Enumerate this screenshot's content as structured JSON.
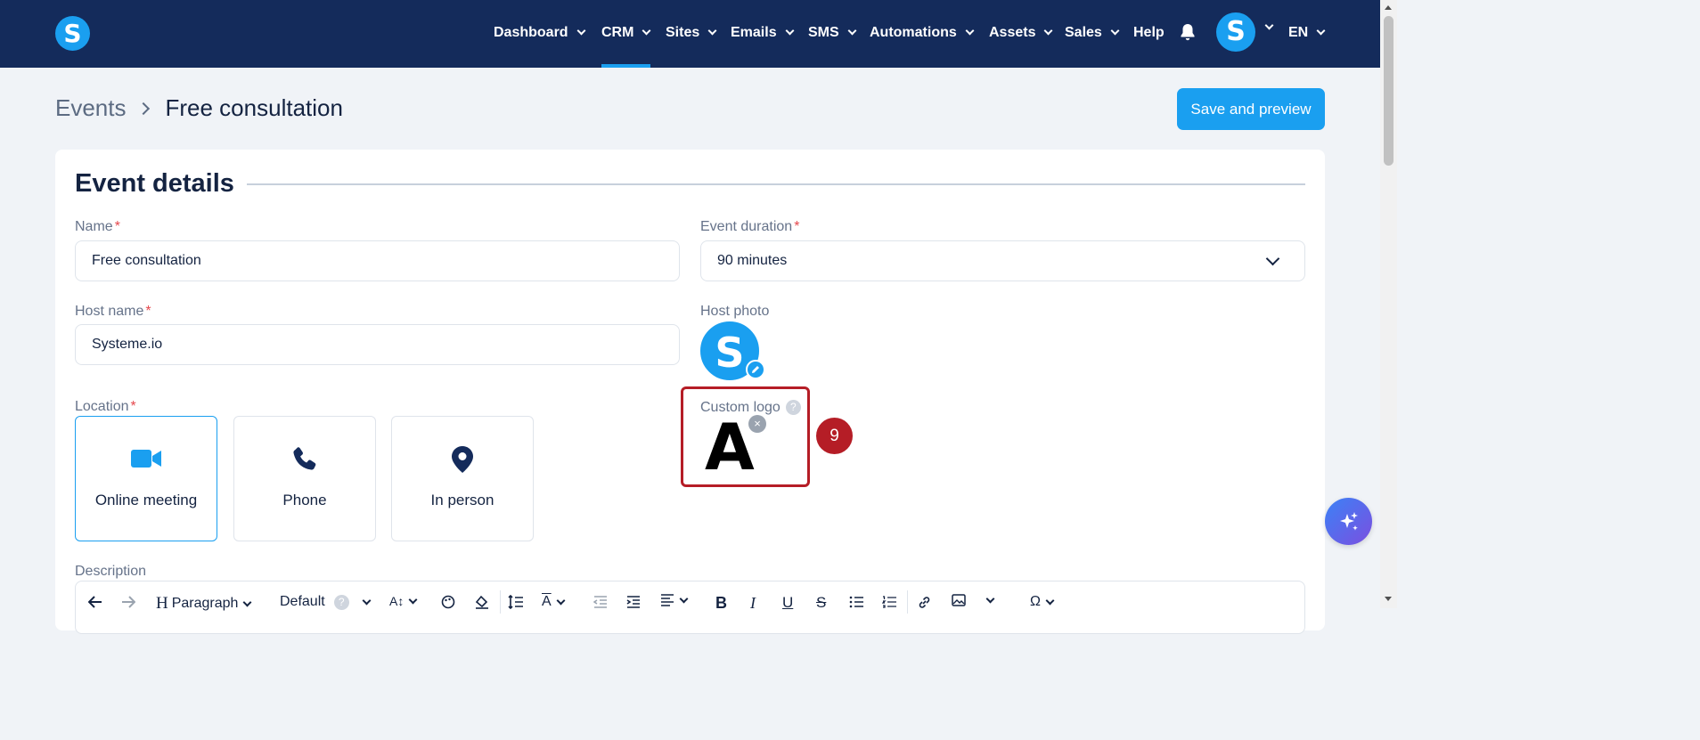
{
  "nav": {
    "brand_letter": "S",
    "items": [
      {
        "label": "Dashboard",
        "has_dropdown": true
      },
      {
        "label": "CRM",
        "has_dropdown": true,
        "active": true
      },
      {
        "label": "Sites",
        "has_dropdown": true
      },
      {
        "label": "Emails",
        "has_dropdown": true
      },
      {
        "label": "SMS",
        "has_dropdown": true
      },
      {
        "label": "Automations",
        "has_dropdown": true
      },
      {
        "label": "Assets",
        "has_dropdown": true
      },
      {
        "label": "Sales",
        "has_dropdown": true
      },
      {
        "label": "Help",
        "has_dropdown": false
      }
    ],
    "avatar_letter": "S",
    "language": "EN"
  },
  "breadcrumb": {
    "parent": "Events",
    "current": "Free consultation"
  },
  "actions": {
    "save_preview": "Save and preview"
  },
  "section": {
    "title": "Event details"
  },
  "form": {
    "name": {
      "label": "Name",
      "required_mark": "*",
      "value": "Free consultation"
    },
    "duration": {
      "label": "Event duration",
      "required_mark": "*",
      "value": "90 minutes"
    },
    "host_name": {
      "label": "Host name",
      "required_mark": "*",
      "value": "Systeme.io"
    },
    "host_photo": {
      "label": "Host photo",
      "letter": "S"
    },
    "location": {
      "label": "Location",
      "required_mark": "*",
      "options": [
        {
          "label": "Online meeting",
          "icon": "video-camera-icon",
          "selected": true
        },
        {
          "label": "Phone",
          "icon": "phone-icon",
          "selected": false
        },
        {
          "label": "In person",
          "icon": "map-pin-icon",
          "selected": false
        }
      ]
    },
    "custom_logo": {
      "label": "Custom logo",
      "help": "?",
      "logo_letter": "A",
      "remove": "×"
    },
    "description": {
      "label": "Description"
    }
  },
  "annotation": {
    "step_number": "9"
  },
  "toolbar": {
    "paragraph": "Paragraph",
    "font": "Default",
    "font_help": "?"
  },
  "colors": {
    "nav_bg": "#142b5b",
    "accent": "#1a9ff0",
    "highlight": "#b51d26"
  }
}
